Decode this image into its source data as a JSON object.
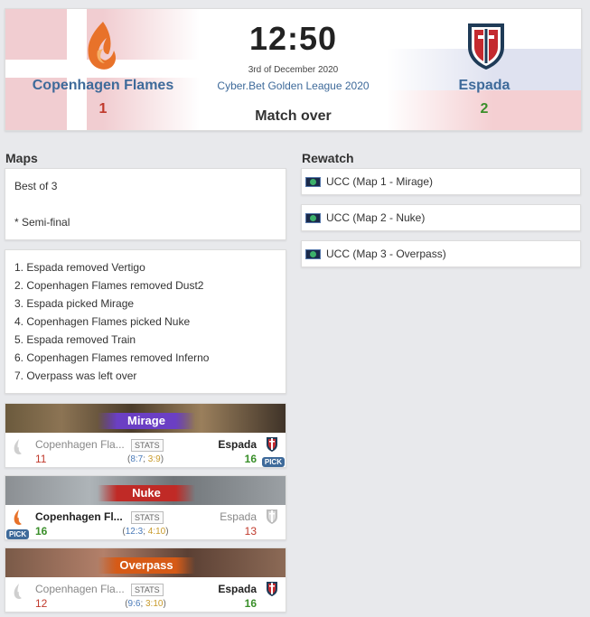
{
  "header": {
    "team1": {
      "name": "Copenhagen Flames",
      "score": "1"
    },
    "team2": {
      "name": "Espada",
      "score": "2"
    },
    "time": "12:50",
    "date": "3rd of December 2020",
    "league": "Cyber.Bet Golden League 2020",
    "status": "Match over"
  },
  "maps_section": {
    "title": "Maps",
    "format_lines": [
      "Best of 3",
      "",
      "* Semi-final"
    ],
    "veto": [
      "1. Espada removed Vertigo",
      "2. Copenhagen Flames removed Dust2",
      "3. Espada picked Mirage",
      "4. Copenhagen Flames picked Nuke",
      "5. Espada removed Train",
      "6. Copenhagen Flames removed Inferno",
      "7. Overpass was left over"
    ]
  },
  "rewatch": {
    "title": "Rewatch",
    "items": [
      "UCC (Map 1 - Mirage)",
      "UCC (Map 2 - Nuke)",
      "UCC (Map 3 - Overpass)"
    ]
  },
  "map_results": [
    {
      "map": "Mirage",
      "team1": "Copenhagen Fla...",
      "team2": "Espada",
      "score1": "11",
      "score2": "16",
      "stats": "STATS",
      "half_open": "(",
      "h1a": "8:7",
      "sep": "; ",
      "h1b": "3:9",
      "half_close": ")",
      "pick": "PICK"
    },
    {
      "map": "Nuke",
      "team1": "Copenhagen Fl...",
      "team2": "Espada",
      "score1": "16",
      "score2": "13",
      "stats": "STATS",
      "half_open": "(",
      "h1a": "12:3",
      "sep": "; ",
      "h1b": "4:10",
      "half_close": ")",
      "pick": "PICK"
    },
    {
      "map": "Overpass",
      "team1": "Copenhagen Fla...",
      "team2": "Espada",
      "score1": "12",
      "score2": "16",
      "stats": "STATS",
      "half_open": "(",
      "h1a": "9:6",
      "sep": "; ",
      "h1b": "3:10",
      "half_close": ")"
    }
  ],
  "colors": {
    "link": "#3e6a9a",
    "win": "#3a8f2a",
    "loss": "#c0392b"
  },
  "icons": {
    "team1_logo": "flame-icon",
    "team2_logo": "shield-sword-icon",
    "rewatch": "stream-thumbnail-icon"
  }
}
